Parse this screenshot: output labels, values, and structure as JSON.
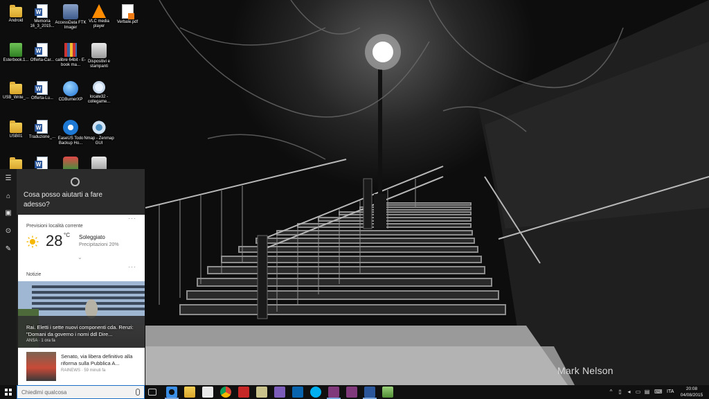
{
  "desktop": {
    "icons": [
      {
        "label": "Android",
        "icon": "folder-icon"
      },
      {
        "label": "Memoria 16_3_2015...",
        "icon": "word-document-icon"
      },
      {
        "label": "AccessData FTK Imager",
        "icon": "drive-imager-icon"
      },
      {
        "label": "VLC media player",
        "icon": "vlc-cone-icon"
      },
      {
        "label": "Verbale.pdf",
        "icon": "pdf-file-icon"
      },
      {
        "label": "Esterbook.1...",
        "icon": "green-book-icon"
      },
      {
        "label": "Offerta-Car...",
        "icon": "word-document-icon"
      },
      {
        "label": "calibre 64bit - E-book ma...",
        "icon": "calibre-books-icon"
      },
      {
        "label": "Dispositivi e stampanti",
        "icon": "printer-icon"
      },
      {
        "label": "USB_Write_...",
        "icon": "folder-icon"
      },
      {
        "label": "Offerta-Lu...",
        "icon": "word-document-icon"
      },
      {
        "label": "CDBurnerXP",
        "icon": "cd-burner-icon"
      },
      {
        "label": "locate32 - collegame...",
        "icon": "magnifier-icon"
      },
      {
        "label": "USB01",
        "icon": "folder-icon"
      },
      {
        "label": "Traduzione_...",
        "icon": "word-document-icon"
      },
      {
        "label": "EaseUS Todo Backup Ho...",
        "icon": "easeus-icon"
      },
      {
        "label": "Nmap - Zenmap GUI",
        "icon": "nmap-eye-icon"
      }
    ],
    "wallpaper_credit": "Mark Nelson"
  },
  "cortana": {
    "prompt": "Cosa posso aiutarti a fare adesso?",
    "rail": [
      "hamburger-menu-icon",
      "home-icon",
      "notebook-icon",
      "location-icon",
      "feedback-icon"
    ],
    "weather": {
      "title": "Previsioni località corrente",
      "temperature": "28",
      "unit": "°C",
      "condition": "Soleggiato",
      "precipitation": "Precipitazioni 20%",
      "more": "···"
    },
    "news": {
      "title": "Notizie",
      "more": "···",
      "headline": "Rai. Eletti i sette nuovi componenti cda. Renzi: \"Domani da governo i nomi ddl Dire...",
      "headline_source": "ANSA · 1 ora fa",
      "item_title": "Senato, via libera definitivo alla riforma sulla Pubblica A...",
      "item_source": "RAINEWS · 59 minuti fa"
    }
  },
  "taskbar": {
    "search_placeholder": "Chiedimi qualcosa",
    "apps": [
      "task-view-icon",
      "edge-icon",
      "file-explorer-icon",
      "store-icon",
      "chrome-icon",
      "app-red-icon",
      "app-notepad-icon",
      "app-purple-icon",
      "outlook-icon",
      "skype-icon",
      "onenote-icon",
      "onenote-2-icon",
      "word-icon",
      "app-tools-icon"
    ],
    "language": "ITA",
    "time": "20:08",
    "date": "04/08/2015"
  },
  "colors": {
    "accent": "#1b6fc4",
    "panel": "#1f1f1f",
    "taskbar": "#101010"
  }
}
